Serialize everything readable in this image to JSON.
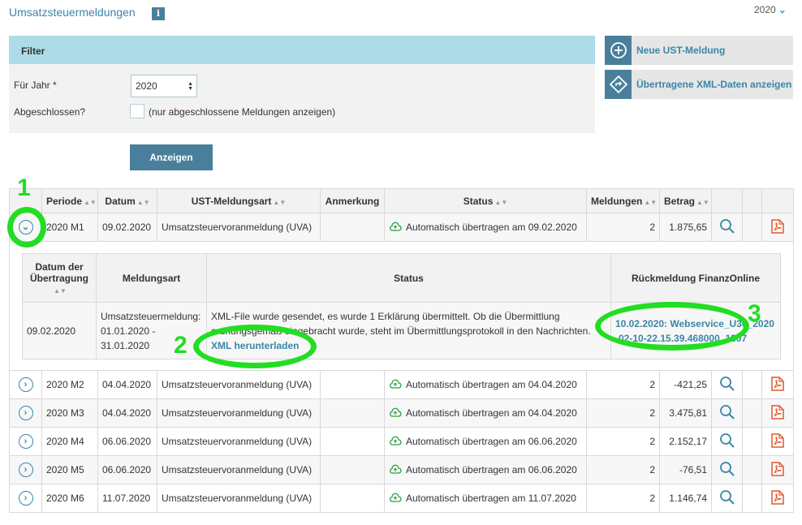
{
  "page": {
    "title": "Umsatzsteuermeldungen",
    "info_icon": "info-icon",
    "year": "2020"
  },
  "filter": {
    "heading": "Filter",
    "year_label": "Für Jahr *",
    "year_value": "2020",
    "closed_label": "Abgeschlossen?",
    "closed_hint": "(nur abgeschlossene Meldungen anzeigen)",
    "show_button": "Anzeigen"
  },
  "actions": {
    "new_label": "Neue UST-Meldung",
    "xml_label": "Übertragene XML-Daten anzeigen"
  },
  "table": {
    "headers": [
      "",
      "Periode",
      "Datum",
      "UST-Meldungsart",
      "Anmerkung",
      "Status",
      "Meldungen",
      "Betrag",
      "",
      "",
      ""
    ],
    "rows": [
      {
        "periode": "2020 M1",
        "datum": "09.02.2020",
        "art": "Umsatzsteuervoranmeldung (UVA)",
        "anmerkung": "",
        "status": "Automatisch übertragen am 09.02.2020",
        "meldungen": "2",
        "betrag": "1.875,65"
      },
      {
        "periode": "2020 M2",
        "datum": "04.04.2020",
        "art": "Umsatzsteuervoranmeldung (UVA)",
        "anmerkung": "",
        "status": "Automatisch übertragen am 04.04.2020",
        "meldungen": "2",
        "betrag": "-421,25"
      },
      {
        "periode": "2020 M3",
        "datum": "04.04.2020",
        "art": "Umsatzsteuervoranmeldung (UVA)",
        "anmerkung": "",
        "status": "Automatisch übertragen am 04.04.2020",
        "meldungen": "2",
        "betrag": "3.475,81"
      },
      {
        "periode": "2020 M4",
        "datum": "06.06.2020",
        "art": "Umsatzsteuervoranmeldung (UVA)",
        "anmerkung": "",
        "status": "Automatisch übertragen am 06.06.2020",
        "meldungen": "2",
        "betrag": "2.152,17"
      },
      {
        "periode": "2020 M5",
        "datum": "06.06.2020",
        "art": "Umsatzsteuervoranmeldung (UVA)",
        "anmerkung": "",
        "status": "Automatisch übertragen am 06.06.2020",
        "meldungen": "2",
        "betrag": "-76,51"
      },
      {
        "periode": "2020 M6",
        "datum": "11.07.2020",
        "art": "Umsatzsteuervoranmeldung (UVA)",
        "anmerkung": "",
        "status": "Automatisch übertragen am 11.07.2020",
        "meldungen": "2",
        "betrag": "1.146,74"
      }
    ]
  },
  "detail": {
    "headers": [
      "Datum der Übertragung",
      "Meldungsart",
      "Status",
      "Rückmeldung FinanzOnline"
    ],
    "datum": "09.02.2020",
    "art": "Umsatzsteuermeldung: 01.01.2020 - 31.01.2020",
    "status_text": "XML-File wurde gesendet, es wurde 1 Erklärung übermittelt. Ob die Übermittlung ordnungsgemäß eingebracht wurde, steht im Übermittlungsprotokoll in den Nachrichten.",
    "download_link": "XML herunterladen",
    "rueckmeldung": "10.02.2020: Webservice_U30_2020-02-10-22.15.39.468000_1307"
  },
  "annotations": [
    "1",
    "2",
    "3"
  ],
  "colors": {
    "accent": "#3a86a6",
    "button": "#4a7f9c",
    "filter_header": "#aedbe8",
    "highlight": "#22dd22",
    "pdf": "#e2572c",
    "cloud": "#2e9e3e"
  }
}
